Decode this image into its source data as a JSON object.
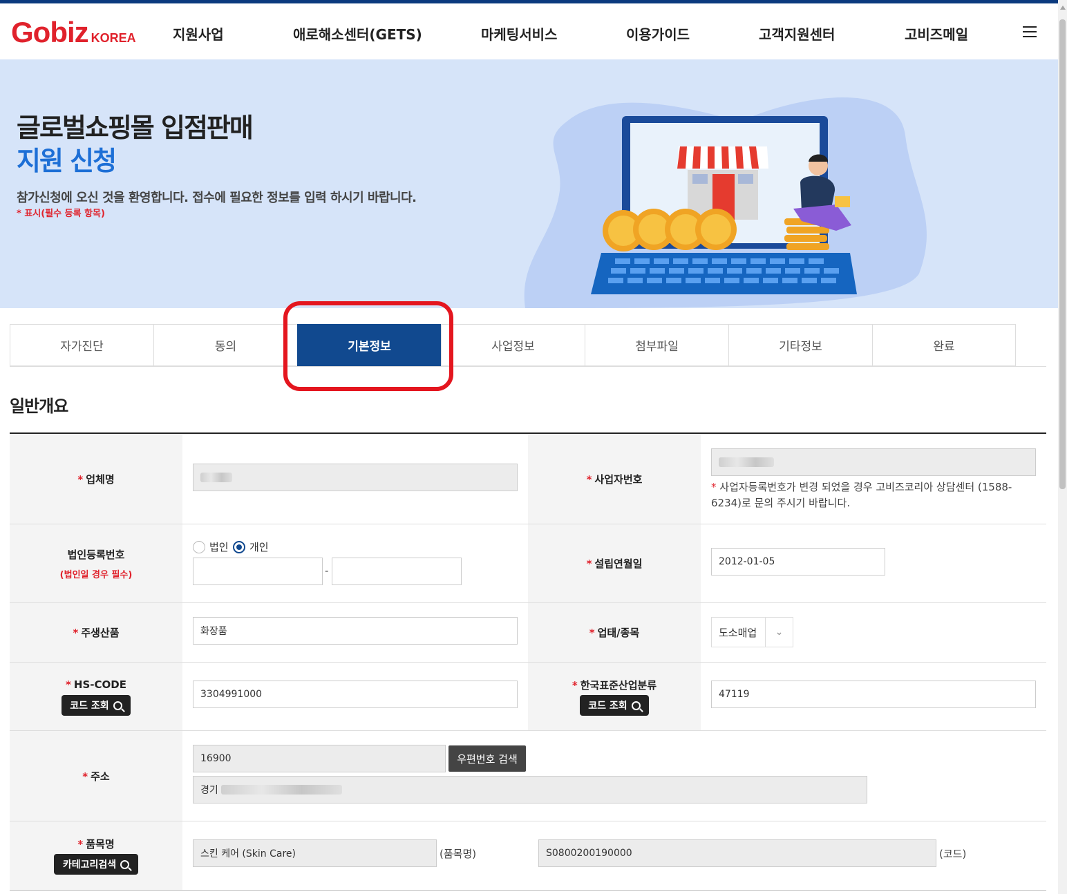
{
  "header": {
    "logo_main": "Gobiz",
    "logo_sub": "KOREA",
    "nav": [
      "지원사업",
      "애로해소센터(GETS)",
      "마케팅서비스",
      "이용가이드",
      "고객지원센터",
      "고비즈메일"
    ]
  },
  "hero": {
    "title_line1": "글로벌쇼핑몰 입점판매",
    "title_line2": "지원 신청",
    "welcome": "참가신청에 오신 것을 환영합니다. 접수에 필요한 정보를 입력 하시기 바랍니다.",
    "required_note": "* 표시(필수 등록 항목)"
  },
  "tabs": [
    "자가진단",
    "동의",
    "기본정보",
    "사업정보",
    "첨부파일",
    "기타정보",
    "완료"
  ],
  "active_tab": "기본정보",
  "section_title": "일반개요",
  "form": {
    "company_name_label": "업체명",
    "business_no_label": "사업자번호",
    "business_no_note": "사업자등록번호가 변경 되었을 경우 고비즈코리아 상담센터 (1588-6234)로 문의 주시기 바랍니다.",
    "corp_reg_label": "법인등록번호",
    "corp_reg_sub": "(법인일 경우 필수)",
    "radio_corp": "법인",
    "radio_individual": "개인",
    "radio_selected": "개인",
    "dash": "-",
    "founded_label": "설립연월일",
    "founded_value": "2012-01-05",
    "main_product_label": "주생산품",
    "main_product_value": "화장품",
    "biz_type_label": "업태/종목",
    "biz_type_value": "도소매업",
    "hs_code_label": "HS-CODE",
    "hs_code_value": "3304991000",
    "code_search_btn": "코드 조회",
    "ksic_label": "한국표준산업분류",
    "ksic_value": "47119",
    "address_label": "주소",
    "zipcode_value": "16900",
    "zipcode_btn": "우편번호 검색",
    "address_prefix": "경기",
    "item_label": "품목명",
    "category_btn": "카테고리검색",
    "item_name_value": "스킨 케어 (Skin Care)",
    "item_name_suffix": "(품목명)",
    "item_code_value": "S0800200190000",
    "item_code_suffix": "(코드)",
    "star": "*"
  },
  "colors": {
    "brand_red": "#e0222c",
    "navy": "#11498f",
    "hero_bg": "#d6e4f9",
    "title_blue": "#1d6fd6",
    "highlight_red": "#e4161f"
  }
}
